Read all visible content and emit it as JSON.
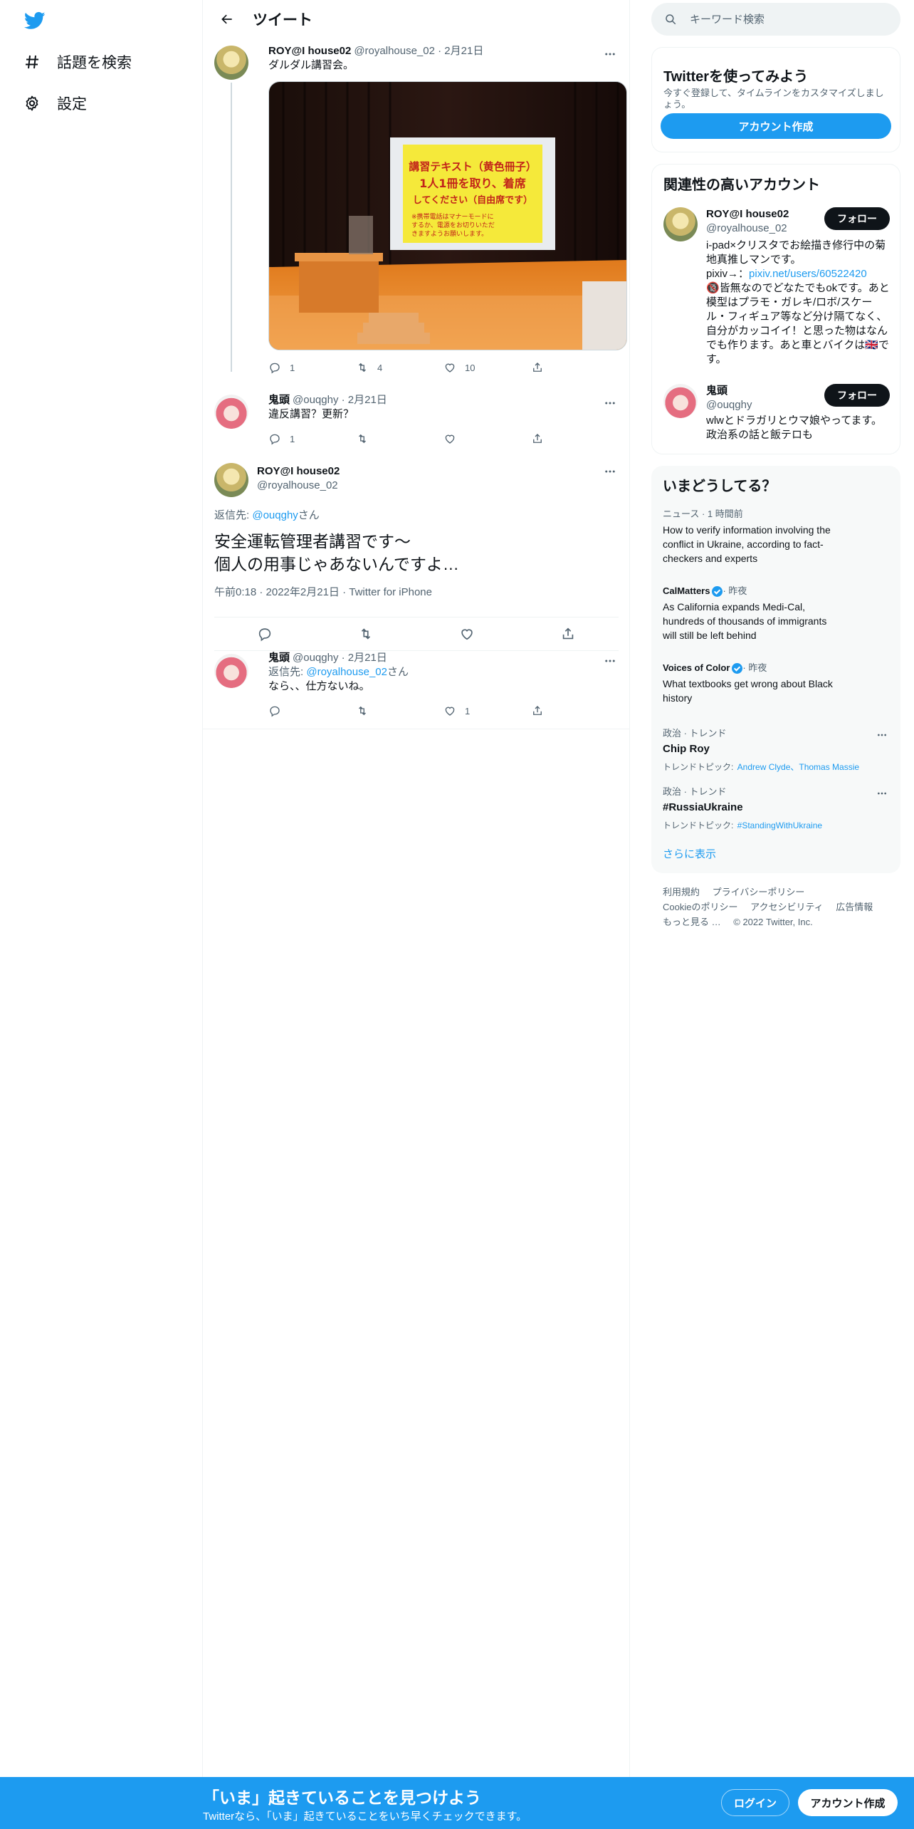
{
  "nav": {
    "explore": "話題を検索",
    "settings": "設定"
  },
  "header": {
    "title": "ツイート"
  },
  "tweets": [
    {
      "name": "ROY@I house02",
      "meta": "@royalhouse_02 · 2月21日",
      "text": "ダルダル講習会。",
      "image_text": [
        "講習テキスト（黄色冊子）",
        "1人1冊を取り、着席",
        "してください（自由席です）",
        "※携帯電話はマナーモードに",
        "するか、電源をお切りいただ",
        "きますようお願いします。"
      ],
      "reply_count": "1",
      "retweet_count": "4",
      "like_count": "10"
    },
    {
      "name": "鬼頭",
      "meta": "@ouqghy · 2月21日",
      "text": "違反講習？更新？",
      "reply_count": "1"
    }
  ],
  "focused": {
    "name": "ROY@I house02",
    "handle": "@royalhouse_02",
    "reply_prefix": "返信先: ",
    "reply_handle": "@ouqghy",
    "reply_suffix": "さん",
    "text_line1": "安全運転管理者講習です〜",
    "text_line2": "個人の用事じゃあないんですよ…",
    "timestamp": "午前0:18 · 2022年2月21日 · Twitter for iPhone"
  },
  "reply": {
    "name": "鬼頭",
    "meta": "@ouqghy · 2月21日",
    "reply_prefix": "返信先: ",
    "reply_handle": "@royalhouse_02",
    "reply_suffix": "さん",
    "text": "なら、、仕方ないね。",
    "like_count": "1"
  },
  "search": {
    "placeholder": "キーワード検索"
  },
  "signup_card": {
    "title": "Twitterを使ってみよう",
    "sub": "今すぐ登録して、タイムラインをカスタマイズしましょう。",
    "button": "アカウント作成"
  },
  "related": {
    "title": "関連性の高いアカウント",
    "follow": "フォロー",
    "accounts": [
      {
        "name": "ROY@I house02",
        "handle": "@royalhouse_02",
        "bio1": "i-pad×クリスタでお絵描き修行中の菊地真推しマンです。",
        "bio_pixiv_prefix": "pixiv→：",
        "bio_pixiv_link": "pixiv.net/users/60522420",
        "bio2": "🔞皆無なのでどなたでもokです。あと模型はプラモ・ガレキ/ロボ/スケール・フィギュア等など分け隔てなく、自分がカッコイイ！と思った物はなんでも作ります。あと車とバイクは🇬🇧です。"
      },
      {
        "name": "鬼頭",
        "handle": "@ouqghy",
        "bio": "wlwとドラガリとウマ娘やってます。政治系の話と飯テロも"
      }
    ]
  },
  "trends": {
    "title": "いまどうしてる？",
    "items": [
      {
        "meta": "ニュース · 1 時間前",
        "title": "How to verify information involving the conflict in Ukraine, according to fact-checkers and experts"
      },
      {
        "source": "CalMatters",
        "meta": " · 昨夜",
        "title": "As California expands Medi-Cal, hundreds of thousands of immigrants will still be left behind"
      },
      {
        "source": "Voices of Color",
        "meta": " · 昨夜",
        "title": "What textbooks get wrong about Black history"
      },
      {
        "meta": "政治 · トレンド",
        "title": "Chip Roy",
        "topics_label": "トレンドトピック: ",
        "topics": "Andrew Clyde、Thomas Massie"
      },
      {
        "meta": "政治 · トレンド",
        "title": "#RussiaUkraine",
        "topics_label": "トレンドトピック: ",
        "topics": "#StandingWithUkraine"
      }
    ],
    "show_more": "さらに表示"
  },
  "footer": {
    "links_row1": [
      "利用規約",
      "プライバシーポリシー"
    ],
    "links_row2": [
      "Cookieのポリシー",
      "アクセシビリティ",
      "広告情報"
    ],
    "more": "もっと見る …",
    "copyright": "© 2022 Twitter, Inc."
  },
  "bottom_bar": {
    "title": "「いま」起きていることを見つけよう",
    "sub": "Twitterなら、「いま」起きていることをいち早くチェックできます。",
    "login": "ログイン",
    "signup": "アカウント作成"
  },
  "colors": {
    "accent": "#1d9bf0",
    "text": "#0f1419",
    "muted": "#536471"
  }
}
